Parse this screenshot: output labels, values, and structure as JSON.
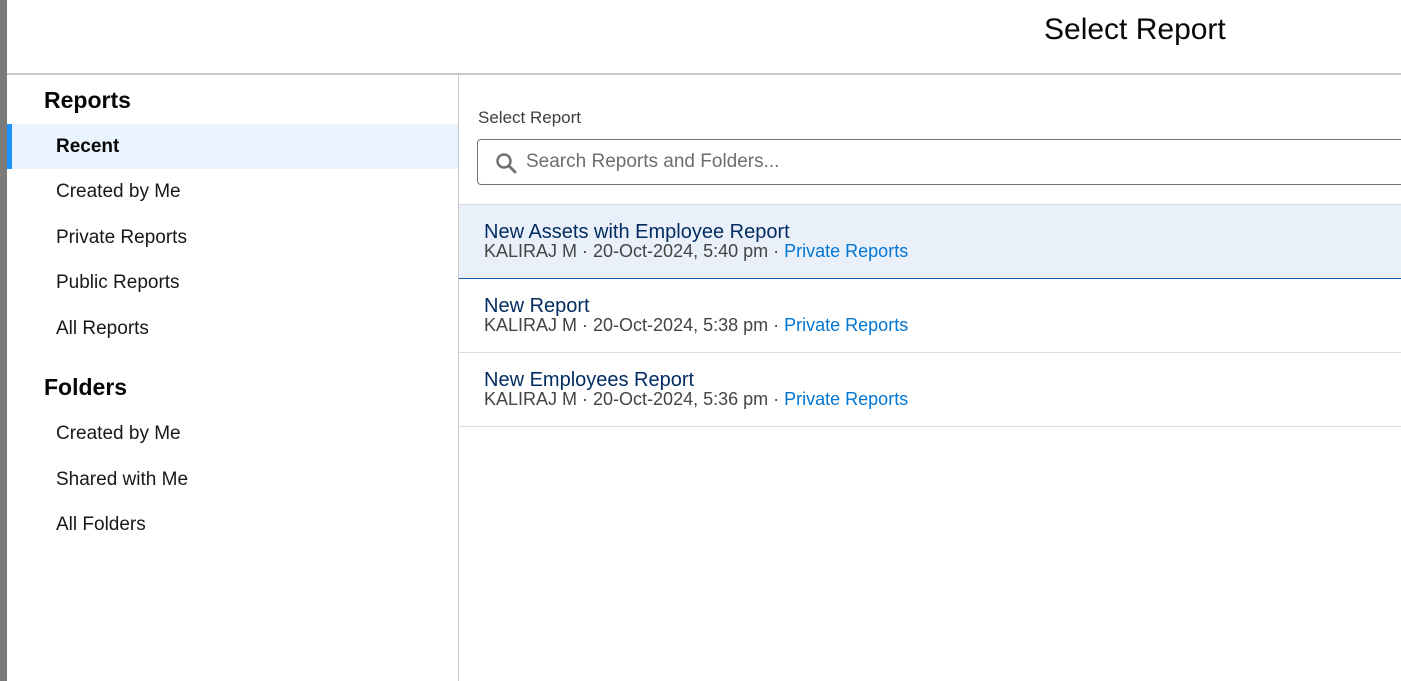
{
  "modal": {
    "title": "Select Report"
  },
  "sidebar": {
    "reports_heading": "Reports",
    "report_items": [
      {
        "label": "Recent",
        "active": true
      },
      {
        "label": "Created by Me"
      },
      {
        "label": "Private Reports"
      },
      {
        "label": "Public Reports"
      },
      {
        "label": "All Reports"
      }
    ],
    "folders_heading": "Folders",
    "folder_items": [
      {
        "label": "Created by Me"
      },
      {
        "label": "Shared with Me"
      },
      {
        "label": "All Folders"
      }
    ]
  },
  "main": {
    "field_label": "Select Report",
    "search": {
      "placeholder": "Search Reports and Folders...",
      "value": ""
    },
    "separator": " · ",
    "results": [
      {
        "title": "New Assets with Employee Report",
        "owner": "KALIRAJ M",
        "date": "20-Oct-2024, 5:40 pm",
        "folder": "Private Reports",
        "selected": true
      },
      {
        "title": "New Report",
        "owner": "KALIRAJ M",
        "date": "20-Oct-2024, 5:38 pm",
        "folder": "Private Reports"
      },
      {
        "title": "New Employees Report",
        "owner": "KALIRAJ M",
        "date": "20-Oct-2024, 5:36 pm",
        "folder": "Private Reports"
      }
    ]
  },
  "colors": {
    "accent": "#1b96ff",
    "link": "#0176d3",
    "title_text": "#032d60",
    "active_bg": "#eaf4fe",
    "selected_bg": "#eaf0f9"
  },
  "icons": {
    "search": "search-icon"
  }
}
